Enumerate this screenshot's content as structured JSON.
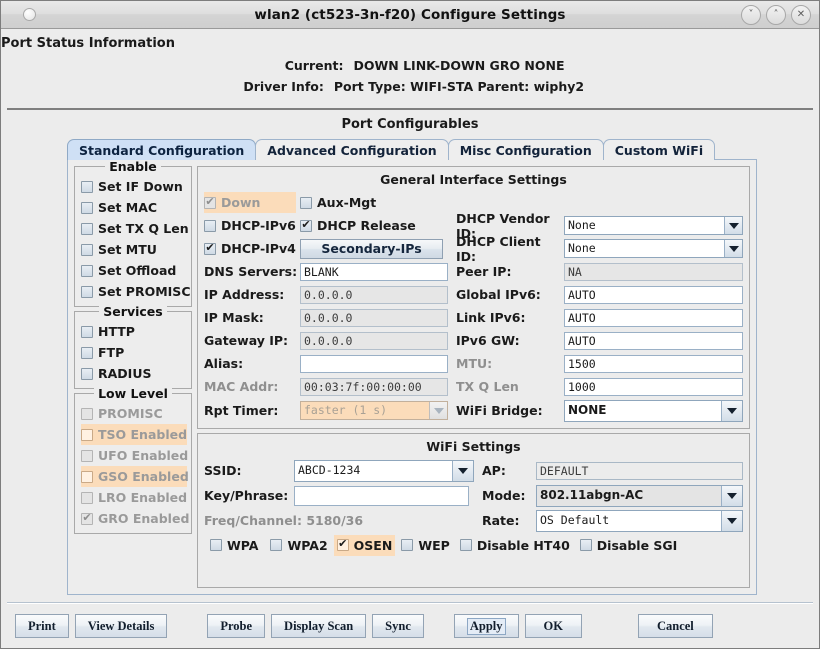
{
  "window": {
    "title": "wlan2  (ct523-3n-f20) Configure Settings",
    "buttons": [
      {
        "name": "minimize",
        "glyph": "˅"
      },
      {
        "name": "maximize",
        "glyph": "˄"
      },
      {
        "name": "close",
        "glyph": "✕"
      }
    ]
  },
  "status": {
    "title": "Port Status Information",
    "current_label": "Current:",
    "current_value": "DOWN LINK-DOWN GRO  NONE",
    "driver_label": "Driver Info:",
    "driver_value": "Port Type: WIFI-STA   Parent: wiphy2"
  },
  "configurables": {
    "title": "Port Configurables",
    "tabs": [
      {
        "label": "Standard Configuration",
        "active": true
      },
      {
        "label": "Advanced Configuration",
        "active": false
      },
      {
        "label": "Misc Configuration",
        "active": false
      },
      {
        "label": "Custom WiFi",
        "active": false
      }
    ]
  },
  "enable_group": {
    "title": "Enable",
    "items": [
      {
        "label": "Set IF Down",
        "checked": false,
        "disabled": false,
        "highlight": false
      },
      {
        "label": "Set MAC",
        "checked": false,
        "disabled": false,
        "highlight": false
      },
      {
        "label": "Set TX Q Len",
        "checked": false,
        "disabled": false,
        "highlight": false
      },
      {
        "label": "Set MTU",
        "checked": false,
        "disabled": false,
        "highlight": false
      },
      {
        "label": "Set Offload",
        "checked": false,
        "disabled": false,
        "highlight": false
      },
      {
        "label": "Set PROMISC",
        "checked": false,
        "disabled": false,
        "highlight": false
      }
    ]
  },
  "services_group": {
    "title": "Services",
    "items": [
      {
        "label": "HTTP",
        "checked": false,
        "disabled": false,
        "highlight": false
      },
      {
        "label": "FTP",
        "checked": false,
        "disabled": false,
        "highlight": false
      },
      {
        "label": "RADIUS",
        "checked": false,
        "disabled": false,
        "highlight": false
      }
    ]
  },
  "lowlevel_group": {
    "title": "Low Level",
    "items": [
      {
        "label": "PROMISC",
        "checked": false,
        "disabled": true,
        "highlight": false
      },
      {
        "label": "TSO Enabled",
        "checked": false,
        "disabled": true,
        "highlight": true
      },
      {
        "label": "UFO Enabled",
        "checked": false,
        "disabled": true,
        "highlight": false
      },
      {
        "label": "GSO Enabled",
        "checked": false,
        "disabled": true,
        "highlight": true
      },
      {
        "label": "LRO Enabled",
        "checked": false,
        "disabled": true,
        "highlight": false
      },
      {
        "label": "GRO Enabled",
        "checked": true,
        "disabled": true,
        "highlight": false
      }
    ]
  },
  "general": {
    "title": "General Interface Settings",
    "down": {
      "label": "Down",
      "checked": true,
      "disabled": true,
      "highlight": true
    },
    "aux_mgt": {
      "label": "Aux-Mgt",
      "checked": false
    },
    "dhcp_ipv6": {
      "label": "DHCP-IPv6",
      "checked": false
    },
    "dhcp_release": {
      "label": "DHCP Release",
      "checked": true
    },
    "dhcp_ipv4": {
      "label": "DHCP-IPv4",
      "checked": true
    },
    "secondary_ips_button": "Secondary-IPs",
    "dhcp_vendor_id": {
      "label": "DHCP Vendor ID:",
      "value": "None"
    },
    "dhcp_client_id": {
      "label": "DHCP Client ID:",
      "value": "None"
    },
    "dns_servers": {
      "label": "DNS Servers:",
      "value": "BLANK"
    },
    "peer_ip": {
      "label": "Peer IP:",
      "value": "NA"
    },
    "ip_address": {
      "label": "IP Address:",
      "value": "0.0.0.0"
    },
    "global_ipv6": {
      "label": "Global IPv6:",
      "value": "AUTO"
    },
    "ip_mask": {
      "label": "IP Mask:",
      "value": "0.0.0.0"
    },
    "link_ipv6": {
      "label": "Link IPv6:",
      "value": "AUTO"
    },
    "gateway_ip": {
      "label": "Gateway IP:",
      "value": "0.0.0.0"
    },
    "ipv6_gw": {
      "label": "IPv6 GW:",
      "value": "AUTO"
    },
    "alias": {
      "label": "Alias:",
      "value": ""
    },
    "mtu": {
      "label": "MTU:",
      "value": "1500"
    },
    "mac_addr": {
      "label": "MAC Addr:",
      "value": "00:03:7f:00:00:00"
    },
    "tx_q_len": {
      "label": "TX Q Len",
      "value": "1000"
    },
    "rpt_timer": {
      "label": "Rpt Timer:",
      "value": "faster   (1 s)"
    },
    "wifi_bridge": {
      "label": "WiFi Bridge:",
      "value": "NONE"
    }
  },
  "wifi": {
    "title": "WiFi Settings",
    "ssid": {
      "label": "SSID:",
      "value": "ABCD-1234"
    },
    "ap": {
      "label": "AP:",
      "value": "DEFAULT"
    },
    "key_phrase": {
      "label": "Key/Phrase:",
      "value": ""
    },
    "mode": {
      "label": "Mode:",
      "value": "802.11abgn-AC"
    },
    "freq_channel": "Freq/Channel: 5180/36",
    "rate": {
      "label": "Rate:",
      "value": "OS Default"
    },
    "security": [
      {
        "label": "WPA",
        "checked": false,
        "highlight": false
      },
      {
        "label": "WPA2",
        "checked": false,
        "highlight": false
      },
      {
        "label": "OSEN",
        "checked": true,
        "highlight": true
      },
      {
        "label": "WEP",
        "checked": false,
        "highlight": false
      },
      {
        "label": "Disable HT40",
        "checked": false,
        "highlight": false
      },
      {
        "label": "Disable SGI",
        "checked": false,
        "highlight": false
      }
    ]
  },
  "footer": {
    "print": "Print",
    "view_details": "View Details",
    "probe": "Probe",
    "display_scan": "Display Scan",
    "sync": "Sync",
    "apply": "Apply",
    "ok": "OK",
    "cancel": "Cancel"
  },
  "colors": {
    "highlight": "#fbdcba",
    "tab_active": "#cfe0f5",
    "window_bg": "#ececec"
  }
}
